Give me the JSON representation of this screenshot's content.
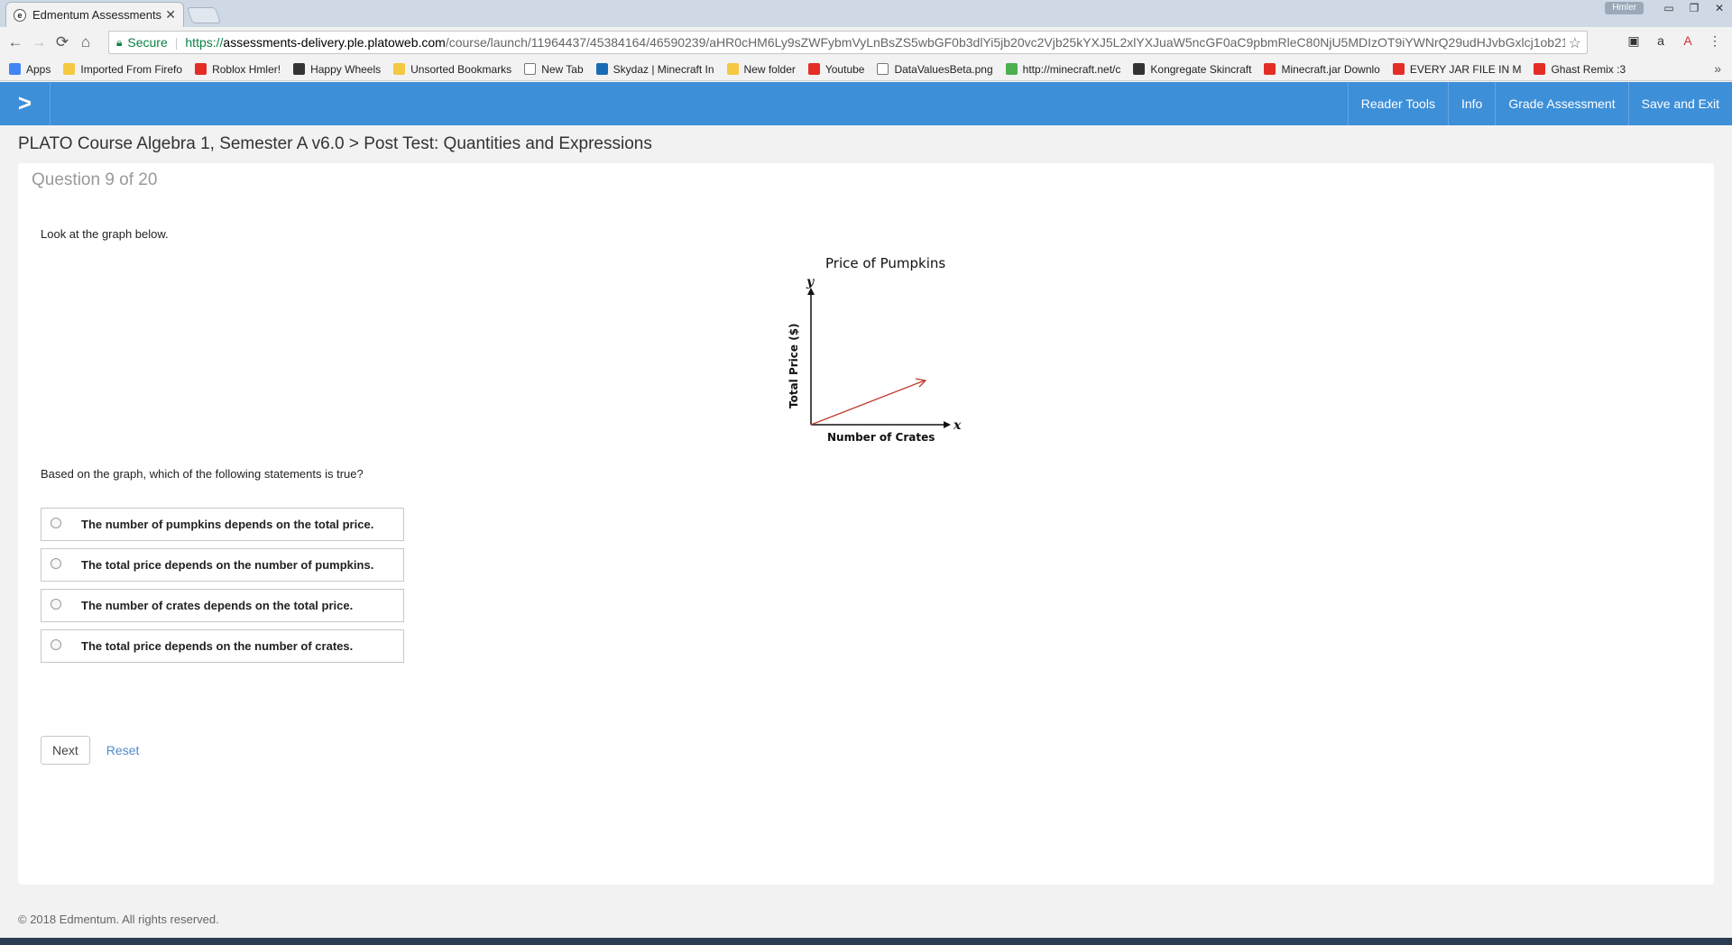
{
  "browser": {
    "tab_title": "Edmentum Assessments",
    "tab_close": "✕",
    "user_label": "Hmler",
    "security_label": "Secure",
    "url_scheme": "https://",
    "url_host": "assessments-delivery.ple.platoweb.com",
    "url_path": "/course/launch/11964437/45384164/46590239/aHR0cHM6Ly9sZWFybmVyLnBsZS5wbGF0b3dlYi5jb20vc2Vjb25kYXJ5L2xlYXJuaW5ncGF0aC9pbmRleC80NjU5MDIzOT9iYWNrQ29udHJvbGxlcj1ob21l",
    "bookmarks": [
      {
        "label": "Apps",
        "icon": "apps-icon"
      },
      {
        "label": "Imported From Firefo",
        "icon": "folder-icon"
      },
      {
        "label": "Roblox Hmler!",
        "icon": "roblox-icon"
      },
      {
        "label": "Happy Wheels",
        "icon": "happy-wheels-icon"
      },
      {
        "label": "Unsorted Bookmarks",
        "icon": "folder-icon"
      },
      {
        "label": "New Tab",
        "icon": "page-icon"
      },
      {
        "label": "Skydaz | Minecraft In",
        "icon": "skydaz-icon"
      },
      {
        "label": "New folder",
        "icon": "folder-icon"
      },
      {
        "label": "Youtube",
        "icon": "youtube-icon"
      },
      {
        "label": "DataValuesBeta.png",
        "icon": "page-icon"
      },
      {
        "label": "http://minecraft.net/c",
        "icon": "minecraft-icon"
      },
      {
        "label": "Kongregate Skincraft",
        "icon": "kongregate-icon"
      },
      {
        "label": "Minecraft.jar Downlo",
        "icon": "youtube-icon"
      },
      {
        "label": "EVERY JAR FILE IN M",
        "icon": "youtube-icon"
      },
      {
        "label": "Ghast Remix :3",
        "icon": "youtube-icon"
      }
    ]
  },
  "toolbar": {
    "reader_tools": "Reader Tools",
    "info": "Info",
    "grade": "Grade Assessment",
    "save_exit": "Save and Exit"
  },
  "breadcrumb": "PLATO Course Algebra 1, Semester A v6.0 > Post Test: Quantities and Expressions",
  "question": {
    "number": "Question 9 of 20",
    "prompt1": "Look at the graph below.",
    "prompt2": "Based on the graph, which of the following statements is true?",
    "options": [
      "The number of pumpkins depends on the total price.",
      "The total price depends on the number of pumpkins.",
      "The number of crates depends on the total price.",
      "The total price depends on the number of crates."
    ]
  },
  "chart_data": {
    "type": "line",
    "title": "Price of Pumpkins",
    "xlabel": "Number of Crates",
    "ylabel": "Total Price ($)",
    "x_axis_letter": "x",
    "y_axis_letter": "y",
    "line_color": "#c0392b"
  },
  "actions": {
    "next": "Next",
    "reset": "Reset"
  },
  "footer": "© 2018 Edmentum. All rights reserved.",
  "colors": {
    "header_blue": "#3d8fd8",
    "link_blue": "#4f8cc9"
  }
}
